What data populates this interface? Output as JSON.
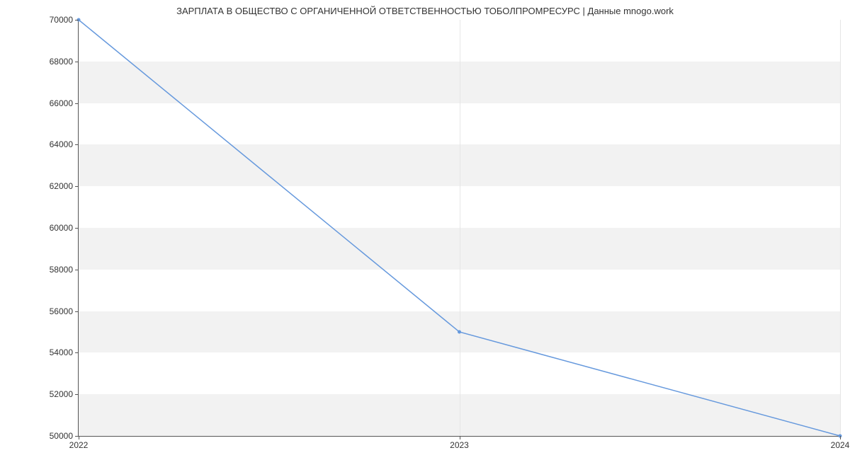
{
  "chart_data": {
    "type": "line",
    "title": "ЗАРПЛАТА В ОБЩЕСТВО С ОРГАНИЧЕННОЙ ОТВЕТСТВЕННОСТЬЮ ТОБОЛПРОМРЕСУРС | Данные mnogo.work",
    "xlabel": "",
    "ylabel": "",
    "x": [
      2022,
      2023,
      2024
    ],
    "values": [
      70000,
      55000,
      50000
    ],
    "x_ticks": [
      2022,
      2023,
      2024
    ],
    "y_ticks": [
      50000,
      52000,
      54000,
      56000,
      58000,
      60000,
      62000,
      64000,
      66000,
      68000,
      70000
    ],
    "xlim": [
      2022,
      2024
    ],
    "ylim": [
      50000,
      70000
    ],
    "band_color": "#f2f2f2",
    "line_color": "#6699dd"
  }
}
